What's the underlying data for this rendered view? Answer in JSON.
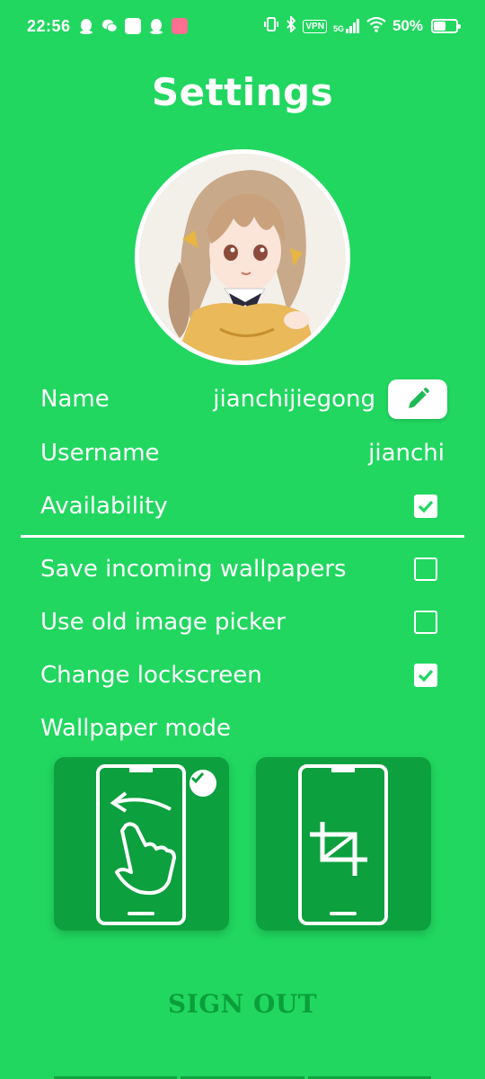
{
  "status_bar": {
    "time": "22:56",
    "vpn": "VPN",
    "network": "5G",
    "battery_text": "50%",
    "battery_level": 0.5
  },
  "header": {
    "title": "Settings"
  },
  "profile": {
    "name_label": "Name",
    "name_value": "jianchijiegong",
    "username_label": "Username",
    "username_value": "jianchi",
    "availability_label": "Availability",
    "availability_checked": true
  },
  "options": [
    {
      "label": "Save incoming wallpapers",
      "checked": false
    },
    {
      "label": "Use old image picker",
      "checked": false
    },
    {
      "label": "Change lockscreen",
      "checked": true
    }
  ],
  "wallpaper_mode": {
    "label": "Wallpaper mode",
    "modes": [
      {
        "icon": "swipe-gesture-icon",
        "selected": true
      },
      {
        "icon": "crop-icon",
        "selected": false
      }
    ]
  },
  "sign_out_label": "SIGN OUT",
  "colors": {
    "background": "#21d760",
    "card": "#0da03e",
    "accent_dark": "#0a9f3a",
    "edit_icon": "#1db954"
  }
}
